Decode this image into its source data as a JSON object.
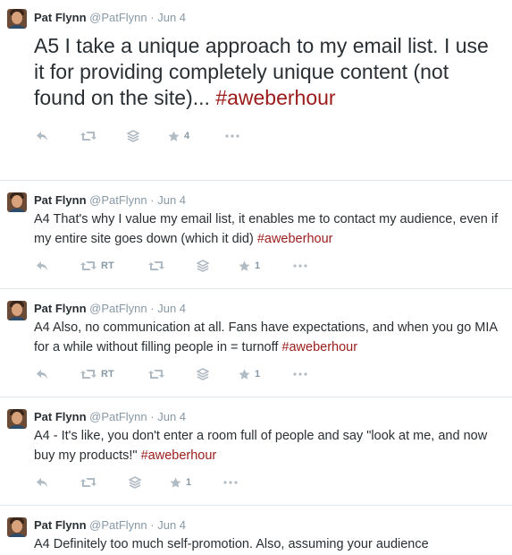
{
  "tweets": [
    {
      "author": "Pat Flynn",
      "handle": "@PatFlynn",
      "separator": "·",
      "date": "Jun 4",
      "text": "A5 I take a unique approach to my email list. I use it for providing completely unique content (not found on the site)... ",
      "hashtag": "#aweberhour",
      "favorites": "4",
      "rt_label": ""
    },
    {
      "author": "Pat Flynn",
      "handle": "@PatFlynn",
      "separator": "·",
      "date": "Jun 4",
      "text": "A4 That's why I value my email list, it enables me to contact my audience, even if my entire site goes down (which it did) ",
      "hashtag": "#aweberhour",
      "favorites": "1",
      "rt_label": "RT"
    },
    {
      "author": "Pat Flynn",
      "handle": "@PatFlynn",
      "separator": "·",
      "date": "Jun 4",
      "text": "A4 Also, no communication at all. Fans have expectations, and when you go MIA for a while without filling people in = turnoff ",
      "hashtag": "#aweberhour",
      "favorites": "1",
      "rt_label": "RT"
    },
    {
      "author": "Pat Flynn",
      "handle": "@PatFlynn",
      "separator": "·",
      "date": "Jun 4",
      "text": "A4 - It's like, you don't enter a room full of people and say \"look at me, and now buy my products!\" ",
      "hashtag": "#aweberhour",
      "favorites": "1",
      "rt_label": ""
    },
    {
      "author": "Pat Flynn",
      "handle": "@PatFlynn",
      "separator": "·",
      "date": "Jun 4",
      "text": "A4 Definitely too much self-promotion. Also, assuming your audience",
      "hashtag": "",
      "favorites": "",
      "rt_label": ""
    }
  ],
  "colors": {
    "hashtag": "#9b1b1b",
    "meta": "#8899a6",
    "icon": "#b1bbc3",
    "divider": "#e1e8ed"
  },
  "icons": [
    "reply-icon",
    "retweet-icon",
    "stack-icon",
    "star-icon",
    "more-icon"
  ]
}
